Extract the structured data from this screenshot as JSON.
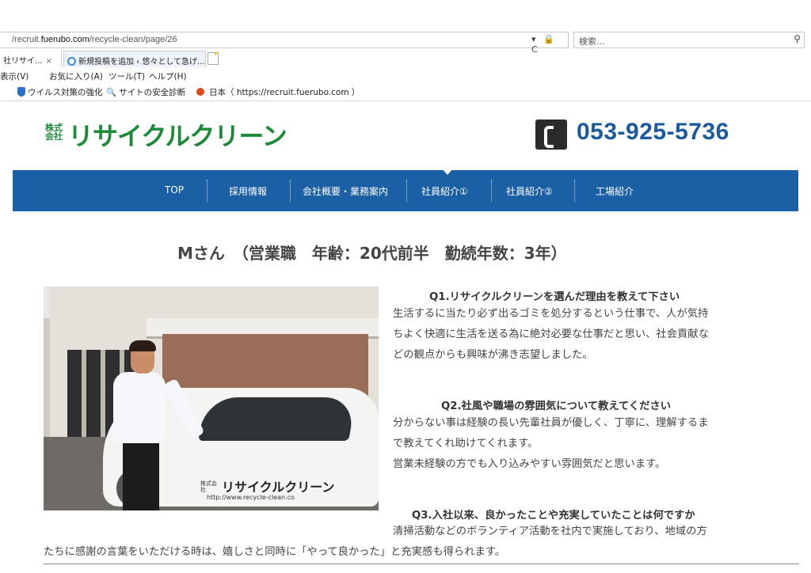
{
  "browser": {
    "url_prefix": "/recruit.",
    "url_domain": "fuerubo.com",
    "url_path": "/recycle-clean/page/26",
    "addr_icons": "▾ 🔒 C",
    "search_placeholder": "検索...",
    "tabs": [
      {
        "label": "社リサイ...",
        "close": "×"
      },
      {
        "label": "新規投稿を追加 ‹ 悠々として急げ..."
      }
    ],
    "menu": [
      "表示(V)",
      "お気に入り(A)",
      "ツール(T)",
      "ヘルプ(H)"
    ],
    "favorites": [
      {
        "label": "ウイルス対策の強化"
      },
      {
        "label": "サイトの安全診断"
      },
      {
        "label": "日本（ https://recruit.fuerubo.com ）"
      }
    ]
  },
  "site": {
    "logo_small": "株式会社",
    "logo_main": "リサイクルクリーン",
    "phone": "053-925-5736",
    "nav": [
      "TOP",
      "採用情報",
      "会社概要・業務案内",
      "社員紹介①",
      "社員紹介②",
      "工場紹介"
    ],
    "page_title": "Mさん　（営業職　年齢：20代前半　勤続年数：3年）",
    "photo_car_text": "リサイクルクリーン",
    "photo_car_sub": "株式会社",
    "photo_car_url": "http://www.recycle-clean.co"
  },
  "qa": [
    {
      "question": "Q1.リサイクルクリーンを選んだ理由を教えて下さい",
      "lines": [
        "生活するに当たり必ず出るゴミを処分するという仕事で、人が気持",
        "ちよく快適に生活を送る為に絶対必要な仕事だと思い、社会貢献な",
        "どの観点からも興味が沸き志望しました。"
      ]
    },
    {
      "question": "Q2.社風や職場の雰囲気について教えてください",
      "lines": [
        "分からない事は経験の長い先輩社員が優しく、丁寧に、理解するま",
        "で教えてくれ助けてくれます。",
        "営業未経験の方でも入り込みやすい雰囲気だと思います。"
      ]
    },
    {
      "question": "Q3.入社以来、良かったことや充実していたことは何ですか",
      "lines": [
        "清掃活動などのボランティア活動を社内で実施しており、地域の方",
        "たちに感謝の言葉をいただける時は、嬉しさと同時に「やって良かった」と充実感も得られます。"
      ]
    }
  ]
}
